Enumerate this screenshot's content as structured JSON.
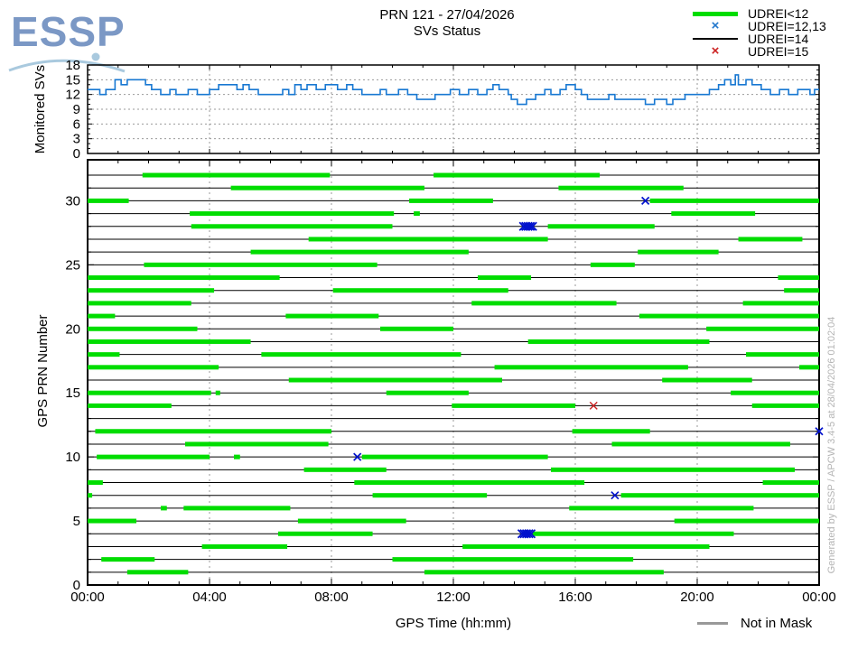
{
  "logo": {
    "text": "ESSP"
  },
  "title": {
    "line1": "PRN 121 - 27/04/2026",
    "line2": "SVs Status"
  },
  "legend": {
    "items": [
      {
        "label": "UDREI<12",
        "marker": "green-line"
      },
      {
        "label": "UDREI=12,13",
        "marker": "blue-x"
      },
      {
        "label": "UDREI=14",
        "marker": "black-line"
      },
      {
        "label": "UDREI=15",
        "marker": "red-x"
      }
    ]
  },
  "footer_legend": {
    "label": "Not in Mask",
    "marker": "gray-line"
  },
  "watermark": "Generated by ESSP / APCW 3.4-5 at 28/04/2026 01:02:04",
  "colors": {
    "green": "#00dd00",
    "blue_line": "#1878d2",
    "blue_marker": "#0011cc",
    "legend_blue_x": "#2277cc",
    "red_marker": "#cc2222",
    "grid": "#999999",
    "not_in_mask": "#999999",
    "logo_blue": "#7b98c5",
    "logo_arc": "#a9c9de",
    "watermark_gray": "#b4b4b4"
  },
  "chart_data": [
    {
      "type": "line",
      "title": "Monitored SVs over time",
      "ylabel": "Monitored SVs",
      "ylim": [
        0,
        18
      ],
      "yticks": [
        0,
        3,
        6,
        9,
        12,
        15,
        18
      ],
      "xlim_hours": [
        0,
        24
      ],
      "xticks_hours": [
        0,
        4,
        8,
        12,
        16,
        20,
        24
      ],
      "xtick_labels": [
        "00:00",
        "04:00",
        "08:00",
        "12:00",
        "16:00",
        "20:00",
        "00:00"
      ],
      "grid": true,
      "legend_position": "none",
      "step_points": [
        [
          0,
          13
        ],
        [
          0.4,
          12
        ],
        [
          0.6,
          13
        ],
        [
          0.9,
          15
        ],
        [
          1.1,
          14
        ],
        [
          1.3,
          15
        ],
        [
          1.7,
          15
        ],
        [
          1.9,
          14
        ],
        [
          2.1,
          13
        ],
        [
          2.4,
          12
        ],
        [
          2.7,
          13
        ],
        [
          2.9,
          12
        ],
        [
          3.3,
          13
        ],
        [
          3.6,
          12
        ],
        [
          4.0,
          13
        ],
        [
          4.3,
          14
        ],
        [
          4.9,
          13
        ],
        [
          5.1,
          14
        ],
        [
          5.3,
          13
        ],
        [
          5.6,
          12
        ],
        [
          6.4,
          13
        ],
        [
          6.6,
          12
        ],
        [
          6.8,
          14
        ],
        [
          7.0,
          13
        ],
        [
          7.2,
          14
        ],
        [
          7.5,
          13
        ],
        [
          7.8,
          14
        ],
        [
          8.2,
          13
        ],
        [
          8.5,
          14
        ],
        [
          8.7,
          13
        ],
        [
          9.0,
          12
        ],
        [
          9.6,
          13
        ],
        [
          9.8,
          12
        ],
        [
          10.2,
          13
        ],
        [
          10.5,
          12
        ],
        [
          10.8,
          11
        ],
        [
          11.4,
          12
        ],
        [
          11.9,
          13
        ],
        [
          12.2,
          12
        ],
        [
          12.5,
          13
        ],
        [
          12.8,
          12
        ],
        [
          13.1,
          13
        ],
        [
          13.3,
          14
        ],
        [
          13.5,
          13
        ],
        [
          13.8,
          12
        ],
        [
          13.9,
          11
        ],
        [
          14.1,
          10
        ],
        [
          14.4,
          11
        ],
        [
          14.7,
          12
        ],
        [
          15.0,
          13
        ],
        [
          15.2,
          12
        ],
        [
          15.5,
          13
        ],
        [
          15.7,
          14
        ],
        [
          16.0,
          13
        ],
        [
          16.2,
          12
        ],
        [
          16.4,
          11
        ],
        [
          17.1,
          12
        ],
        [
          17.3,
          11
        ],
        [
          18.3,
          10
        ],
        [
          18.6,
          11
        ],
        [
          19.0,
          10
        ],
        [
          19.2,
          11
        ],
        [
          19.6,
          12
        ],
        [
          20.1,
          12
        ],
        [
          20.4,
          13
        ],
        [
          20.7,
          14
        ],
        [
          20.9,
          15
        ],
        [
          21.1,
          14
        ],
        [
          21.25,
          16
        ],
        [
          21.35,
          14
        ],
        [
          21.6,
          15
        ],
        [
          21.8,
          14
        ],
        [
          22.1,
          13
        ],
        [
          22.4,
          12
        ],
        [
          22.7,
          13
        ],
        [
          23.0,
          12
        ],
        [
          23.3,
          13
        ],
        [
          23.7,
          12
        ],
        [
          23.85,
          13
        ],
        [
          24,
          13
        ]
      ]
    },
    {
      "type": "gantt",
      "title": "SVs Status per GPS PRN",
      "ylabel": "GPS PRN Number",
      "xlabel": "GPS Time (hh:mm)",
      "ylim": [
        0,
        33.2
      ],
      "yticks": [
        0,
        5,
        10,
        15,
        20,
        25,
        30
      ],
      "xlim_hours": [
        0,
        24
      ],
      "xticks_hours": [
        0,
        4,
        8,
        12,
        16,
        20,
        24
      ],
      "xtick_labels": [
        "00:00",
        "04:00",
        "08:00",
        "12:00",
        "16:00",
        "20:00",
        "00:00"
      ],
      "grid": true,
      "segment_meaning": "UDREI<12 (green)",
      "baseline_meaning": "UDREI=14 (black line)",
      "rows": [
        {
          "prn": 1,
          "segments": [
            [
              1.3,
              3.3
            ],
            [
              11.05,
              18.9
            ]
          ],
          "markers": []
        },
        {
          "prn": 2,
          "segments": [
            [
              0.45,
              2.2
            ],
            [
              10.0,
              17.9
            ]
          ],
          "markers": []
        },
        {
          "prn": 3,
          "segments": [
            [
              3.75,
              6.55
            ],
            [
              12.3,
              20.4
            ]
          ],
          "markers": []
        },
        {
          "prn": 4,
          "segments": [
            [
              6.25,
              9.35
            ],
            [
              14.6,
              21.2
            ]
          ],
          "markers": [
            {
              "t": 14.4,
              "type": "blue-x-cluster"
            }
          ]
        },
        {
          "prn": 5,
          "segments": [
            [
              0,
              1.6
            ],
            [
              6.9,
              10.45
            ],
            [
              19.25,
              24
            ]
          ],
          "markers": []
        },
        {
          "prn": 6,
          "segments": [
            [
              2.4,
              2.6
            ],
            [
              3.15,
              6.65
            ],
            [
              15.8,
              21.85
            ]
          ],
          "markers": []
        },
        {
          "prn": 7,
          "segments": [
            [
              0,
              0.15
            ],
            [
              9.35,
              13.1
            ],
            [
              17.5,
              24
            ]
          ],
          "markers": [
            {
              "t": 17.3,
              "type": "blue-x"
            }
          ]
        },
        {
          "prn": 8,
          "segments": [
            [
              0,
              0.5
            ],
            [
              8.75,
              16.3
            ],
            [
              22.15,
              24
            ]
          ],
          "markers": []
        },
        {
          "prn": 9,
          "segments": [
            [
              7.1,
              9.8
            ],
            [
              15.2,
              23.2
            ]
          ],
          "markers": []
        },
        {
          "prn": 10,
          "segments": [
            [
              0.3,
              4.0
            ],
            [
              4.8,
              5.0
            ],
            [
              9.0,
              15.1
            ]
          ],
          "markers": [
            {
              "t": 8.85,
              "type": "blue-x"
            }
          ]
        },
        {
          "prn": 11,
          "segments": [
            [
              3.2,
              7.9
            ],
            [
              17.2,
              23.05
            ]
          ],
          "markers": []
        },
        {
          "prn": 12,
          "segments": [
            [
              0.25,
              8.0
            ],
            [
              15.9,
              18.45
            ]
          ],
          "markers": [
            {
              "t": 24,
              "type": "blue-x"
            }
          ]
        },
        {
          "prn": 13,
          "segments": [],
          "markers": []
        },
        {
          "prn": 14,
          "segments": [
            [
              0,
              2.75
            ],
            [
              11.95,
              16.0
            ],
            [
              21.8,
              24
            ]
          ],
          "markers": [
            {
              "t": 16.6,
              "type": "red-x"
            }
          ]
        },
        {
          "prn": 15,
          "segments": [
            [
              0,
              4.05
            ],
            [
              4.2,
              4.35
            ],
            [
              9.8,
              12.5
            ],
            [
              21.1,
              24
            ]
          ],
          "markers": []
        },
        {
          "prn": 16,
          "segments": [
            [
              6.6,
              13.6
            ],
            [
              18.85,
              21.8
            ]
          ],
          "markers": []
        },
        {
          "prn": 17,
          "segments": [
            [
              0,
              4.3
            ],
            [
              13.35,
              19.7
            ],
            [
              23.35,
              24
            ]
          ],
          "markers": []
        },
        {
          "prn": 18,
          "segments": [
            [
              0,
              1.05
            ],
            [
              5.7,
              12.25
            ],
            [
              21.6,
              24
            ]
          ],
          "markers": []
        },
        {
          "prn": 19,
          "segments": [
            [
              0,
              5.35
            ],
            [
              14.45,
              20.4
            ]
          ],
          "markers": []
        },
        {
          "prn": 20,
          "segments": [
            [
              0,
              3.6
            ],
            [
              9.6,
              12.0
            ],
            [
              20.3,
              24
            ]
          ],
          "markers": []
        },
        {
          "prn": 21,
          "segments": [
            [
              0,
              0.9
            ],
            [
              6.5,
              9.55
            ],
            [
              18.1,
              24
            ]
          ],
          "markers": []
        },
        {
          "prn": 22,
          "segments": [
            [
              0,
              3.4
            ],
            [
              12.6,
              17.35
            ],
            [
              21.5,
              24
            ]
          ],
          "markers": []
        },
        {
          "prn": 23,
          "segments": [
            [
              0,
              4.15
            ],
            [
              8.05,
              13.8
            ],
            [
              22.85,
              24
            ]
          ],
          "markers": []
        },
        {
          "prn": 24,
          "segments": [
            [
              0,
              6.3
            ],
            [
              12.8,
              14.55
            ],
            [
              22.65,
              24
            ]
          ],
          "markers": []
        },
        {
          "prn": 25,
          "segments": [
            [
              1.85,
              9.5
            ],
            [
              16.5,
              17.95
            ]
          ],
          "markers": []
        },
        {
          "prn": 26,
          "segments": [
            [
              5.35,
              12.5
            ],
            [
              18.05,
              20.7
            ]
          ],
          "markers": []
        },
        {
          "prn": 27,
          "segments": [
            [
              7.25,
              15.1
            ],
            [
              21.35,
              23.45
            ]
          ],
          "markers": []
        },
        {
          "prn": 28,
          "segments": [
            [
              3.4,
              10.0
            ],
            [
              15.1,
              18.6
            ]
          ],
          "markers": [
            {
              "t": 14.45,
              "type": "blue-x-cluster"
            }
          ]
        },
        {
          "prn": 29,
          "segments": [
            [
              3.35,
              10.05
            ],
            [
              10.7,
              10.9
            ],
            [
              19.15,
              21.9
            ]
          ],
          "markers": []
        },
        {
          "prn": 30,
          "segments": [
            [
              0,
              1.35
            ],
            [
              10.55,
              13.3
            ],
            [
              18.45,
              24
            ]
          ],
          "markers": [
            {
              "t": 18.3,
              "type": "blue-x"
            }
          ]
        },
        {
          "prn": 31,
          "segments": [
            [
              4.7,
              11.05
            ],
            [
              15.45,
              19.55
            ]
          ],
          "markers": []
        },
        {
          "prn": 32,
          "segments": [
            [
              1.8,
              7.95
            ],
            [
              11.35,
              16.8
            ]
          ],
          "markers": []
        }
      ]
    }
  ]
}
